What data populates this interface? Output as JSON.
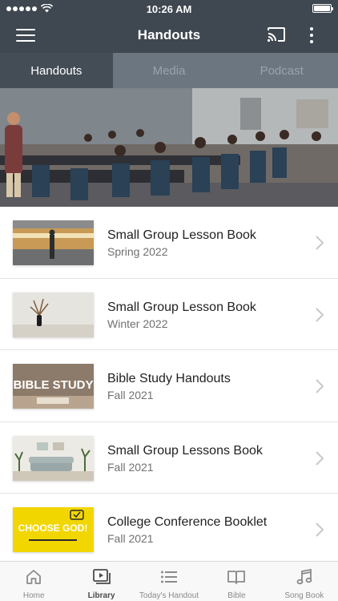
{
  "status_bar": {
    "time": "10:26 AM"
  },
  "header": {
    "title": "Handouts"
  },
  "tabs": [
    {
      "label": "Handouts",
      "active": true
    },
    {
      "label": "Media",
      "active": false
    },
    {
      "label": "Podcast",
      "active": false
    }
  ],
  "handouts": [
    {
      "title": "Small Group Lesson Book",
      "subtitle": "Spring 2022",
      "thumbnail": "train-photo"
    },
    {
      "title": "Small Group Lesson Book",
      "subtitle": "Winter 2022",
      "thumbnail": "vase-photo"
    },
    {
      "title": "Bible Study Handouts",
      "subtitle": "Fall 2021",
      "thumbnail": "bible-study-photo",
      "thumbnail_text": "BIBLE STUDY"
    },
    {
      "title": "Small Group Lessons Book",
      "subtitle": "Fall 2021",
      "thumbnail": "living-room-photo"
    },
    {
      "title": "College Conference Booklet",
      "subtitle": "Fall 2021",
      "thumbnail": "choose-god-graphic",
      "thumbnail_text": "CHOOSE GOD!"
    }
  ],
  "tab_bar": [
    {
      "label": "Home",
      "icon": "home-icon",
      "active": false
    },
    {
      "label": "Library",
      "icon": "library-icon",
      "active": true
    },
    {
      "label": "Today's Handout",
      "icon": "list-icon",
      "active": false
    },
    {
      "label": "Bible",
      "icon": "book-icon",
      "active": false
    },
    {
      "label": "Song Book",
      "icon": "music-note-icon",
      "active": false
    }
  ],
  "colors": {
    "header_bg": "#3f4750",
    "tabs_bg": "#6c7680",
    "tab_active_bg": "#444d56",
    "accent_yellow": "#f2d600"
  }
}
